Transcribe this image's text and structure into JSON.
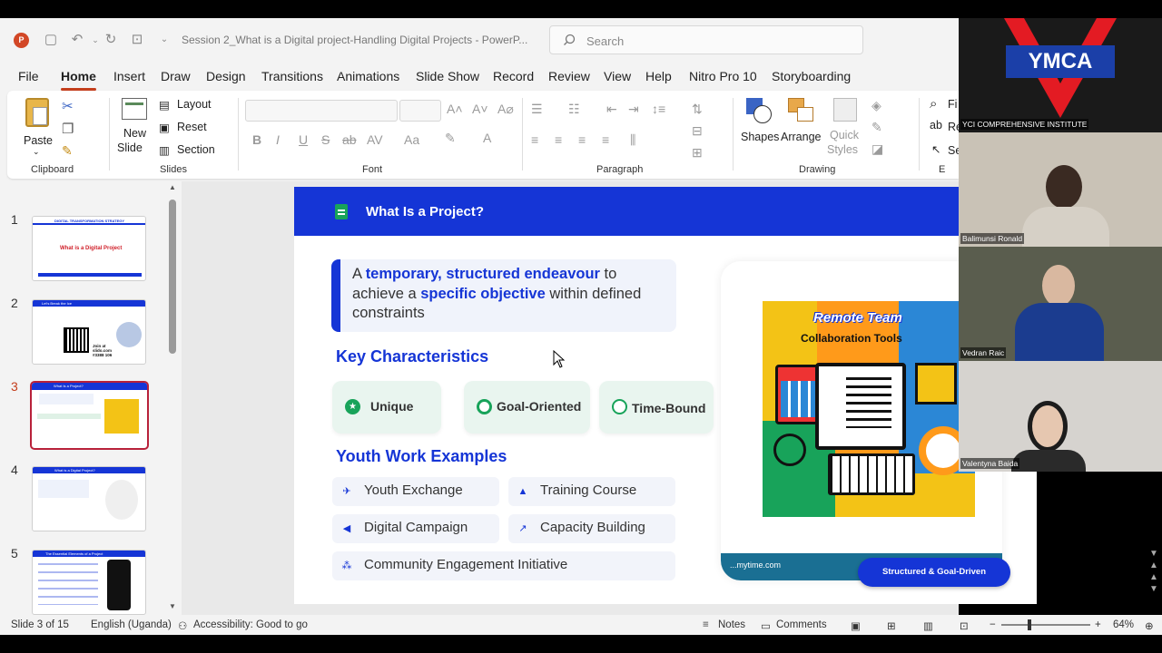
{
  "app": {
    "doc_title": "Session 2_What is a Digital project-Handling Digital Projects  -  PowerP...",
    "search_placeholder": "Search"
  },
  "menu": [
    "File",
    "Home",
    "Insert",
    "Draw",
    "Design",
    "Transitions",
    "Animations",
    "Slide Show",
    "Record",
    "Review",
    "View",
    "Help",
    "Nitro Pro 10",
    "Storyboarding"
  ],
  "ribbon": {
    "clipboard": {
      "paste": "Paste",
      "label": "Clipboard"
    },
    "slides": {
      "new_slide_1": "New",
      "new_slide_2": "Slide",
      "layout": "Layout",
      "reset": "Reset",
      "section": "Section",
      "label": "Slides"
    },
    "font": {
      "label": "Font",
      "bold": "B",
      "italic": "I",
      "underline": "U",
      "strike": "S",
      "shadow": "ab",
      "spacing": "AV",
      "case": "Aa"
    },
    "paragraph": {
      "label": "Paragraph"
    },
    "drawing": {
      "shapes": "Shapes",
      "arrange": "Arrange",
      "quick_1": "Quick",
      "quick_2": "Styles",
      "label": "Drawing"
    },
    "editing": {
      "find": "Fi",
      "replace": "Re",
      "select": "Se",
      "label": "E"
    }
  },
  "thumbnails": [
    {
      "num": "1",
      "title": "DIGITAL TRANSFORMATION STRATEGY",
      "subtitle": "What is a Digital Project"
    },
    {
      "num": "2",
      "title": "Let's Break the Ice",
      "subtitle": "Join at slido.com #3388 106"
    },
    {
      "num": "3",
      "title": "What Is a Project?",
      "subtitle": ""
    },
    {
      "num": "4",
      "title": "What is a Digital Project?",
      "subtitle": ""
    },
    {
      "num": "5",
      "title": "The Essential Elements of a Project",
      "subtitle": ""
    }
  ],
  "slide": {
    "title": "What Is a Project?",
    "definition": {
      "p1": "A ",
      "h1": "temporary, structured endeavour",
      "p2": " to achieve a ",
      "h2": "specific objective",
      "p3": " within defined constraints"
    },
    "key_heading": "Key Characteristics",
    "characteristics": [
      "Unique",
      "Goal-Oriented",
      "Time-Bound"
    ],
    "youth_heading": "Youth Work Examples",
    "examples": [
      "Youth Exchange",
      "Training Course",
      "Digital Campaign",
      "Capacity Building",
      "Community Engagement Initiative"
    ],
    "image": {
      "line1": "Remote Team",
      "line2": "Collaboration Tools",
      "credit": "...mytime.com"
    },
    "badge": "Structured & Goal-Driven"
  },
  "status": {
    "slide_info": "Slide 3 of 15",
    "language": "English (Uganda)",
    "accessibility": "Accessibility: Good to go",
    "notes": "Notes",
    "comments": "Comments",
    "zoom": "64%"
  },
  "participants": [
    {
      "name": "YCI COMPREHENSIVE INSTITUTE",
      "logo": "YMCA"
    },
    {
      "name": "Balimunsi Ronald"
    },
    {
      "name": "Vedran Raic"
    },
    {
      "name": "Valentyna Baida"
    }
  ],
  "colors": {
    "accent": "#1535d6",
    "ppt": "#c43e1c",
    "chip_bg": "#e9f5ef",
    "icon_green": "#18a35a"
  }
}
